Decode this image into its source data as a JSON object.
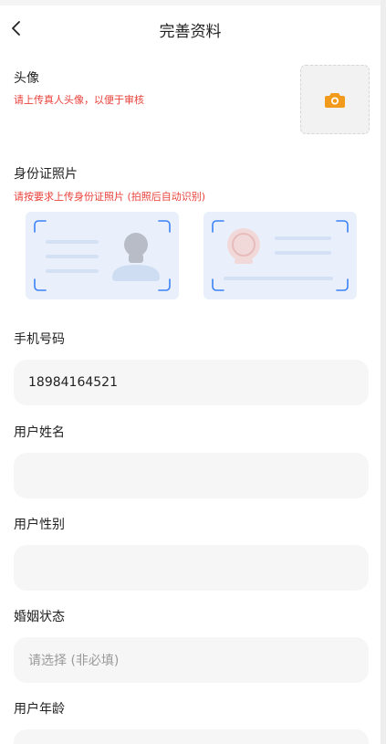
{
  "header": {
    "title": "完善资料"
  },
  "avatar": {
    "label": "头像",
    "hint": "请上传真人头像，以便于审核"
  },
  "id_photo": {
    "label": "身份证照片",
    "hint": "请按要求上传身份证照片 (拍照后自动识别)"
  },
  "fields": [
    {
      "label": "手机号码",
      "value": "18984164521",
      "placeholder": ""
    },
    {
      "label": "用户姓名",
      "value": "",
      "placeholder": ""
    },
    {
      "label": "用户性别",
      "value": "",
      "placeholder": ""
    },
    {
      "label": "婚姻状态",
      "value": "",
      "placeholder": "请选择 (非必填)"
    },
    {
      "label": "用户年龄",
      "value": "",
      "placeholder": ""
    }
  ],
  "colors": {
    "hint_red": "#e8423b",
    "camera_orange": "#f29a1b",
    "id_card_bg": "#e9f0fb"
  }
}
